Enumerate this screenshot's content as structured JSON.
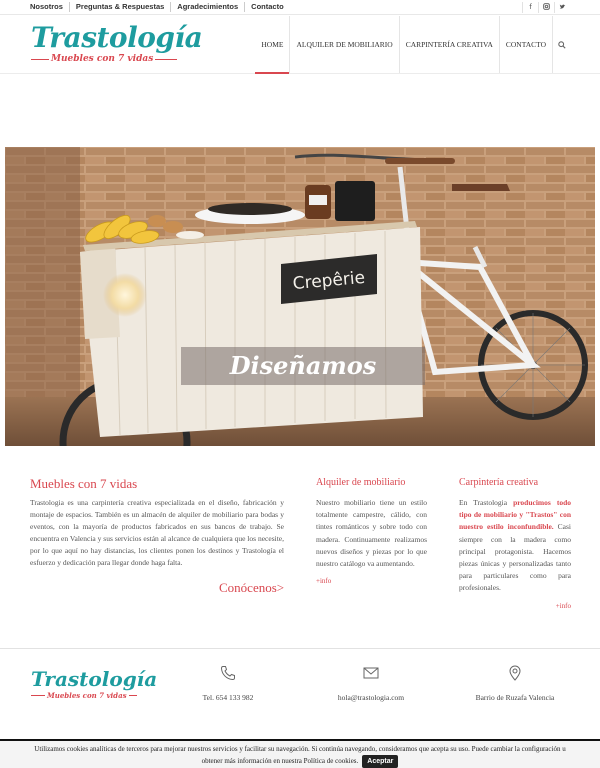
{
  "topbar": {
    "links": [
      "Nosotros",
      "Preguntas & Respuestas",
      "Agradecimientos",
      "Contacto"
    ],
    "social": [
      "facebook-icon",
      "instagram-icon",
      "twitter-icon"
    ]
  },
  "brand": {
    "name": "Trastología",
    "tagline": "Muebles con 7 vidas",
    "teal": "#1e9c9f",
    "red": "#d9474f"
  },
  "nav": {
    "items": [
      "HOME",
      "ALQUILER DE MOBILIARIO",
      "CARPINTERÍA CREATIVA",
      "CONTACTO"
    ],
    "active": "HOME"
  },
  "hero": {
    "title": "Diseñamos",
    "sign": "Crepêrie"
  },
  "about": {
    "title": "Muebles con 7 vidas",
    "text": "Trastologia es una carpintería creativa especializada en el diseño, fabricación y montaje de espacios. También es un almacén de alquiler de mobiliario para bodas y eventos, con la mayoría de productos fabricados en sus bancos de trabajo. Se encuentra en Valencia y sus servicios están al alcance de cualquiera que los necesite, por lo que aquí no hay distancias, los clientes ponen los destinos y Trastología el esfuerzo y dedicación para llegar donde haga falta.",
    "cta": "Conócenos>"
  },
  "rental": {
    "title": "Alquiler de mobiliario",
    "text": "Nuestro mobiliario tiene un estilo totalmente campestre, cálido, con tintes románticos y sobre todo con madera. Continuamente realizamos nuevos diseños y piezas por lo que nuestro catálogo va aumentando.",
    "more": "+info"
  },
  "carpentry": {
    "title": "Carpintería creativa",
    "text_before": "En Trastologia ",
    "highlight": "producimos todo tipo de mobiliario y \"Trastos\" con nuestro estilo inconfundible.",
    "text_after": " Casi siempre con la madera como principal protagonista. Hacemos piezas únicas y personalizadas tanto para particulares como para profesionales.",
    "more": "+info"
  },
  "footer": {
    "logo_name": "Trastología",
    "logo_tagline": "Muebles con 7 vidas",
    "phone": "Tel. 654 133 982",
    "email": "hola@trastologia.com",
    "location": "Barrio de Ruzafa Valencia"
  },
  "cookie": {
    "text_line1": "Utilizamos cookies analíticas de terceros para mejorar nuestros servicios y facilitar su navegación. Si continúa navegando, consideramos que acepta su uso. Puede cambiar la configuración u",
    "text_line2": "obtener más información en nuestra Política de cookies.",
    "button": "Aceptar"
  }
}
